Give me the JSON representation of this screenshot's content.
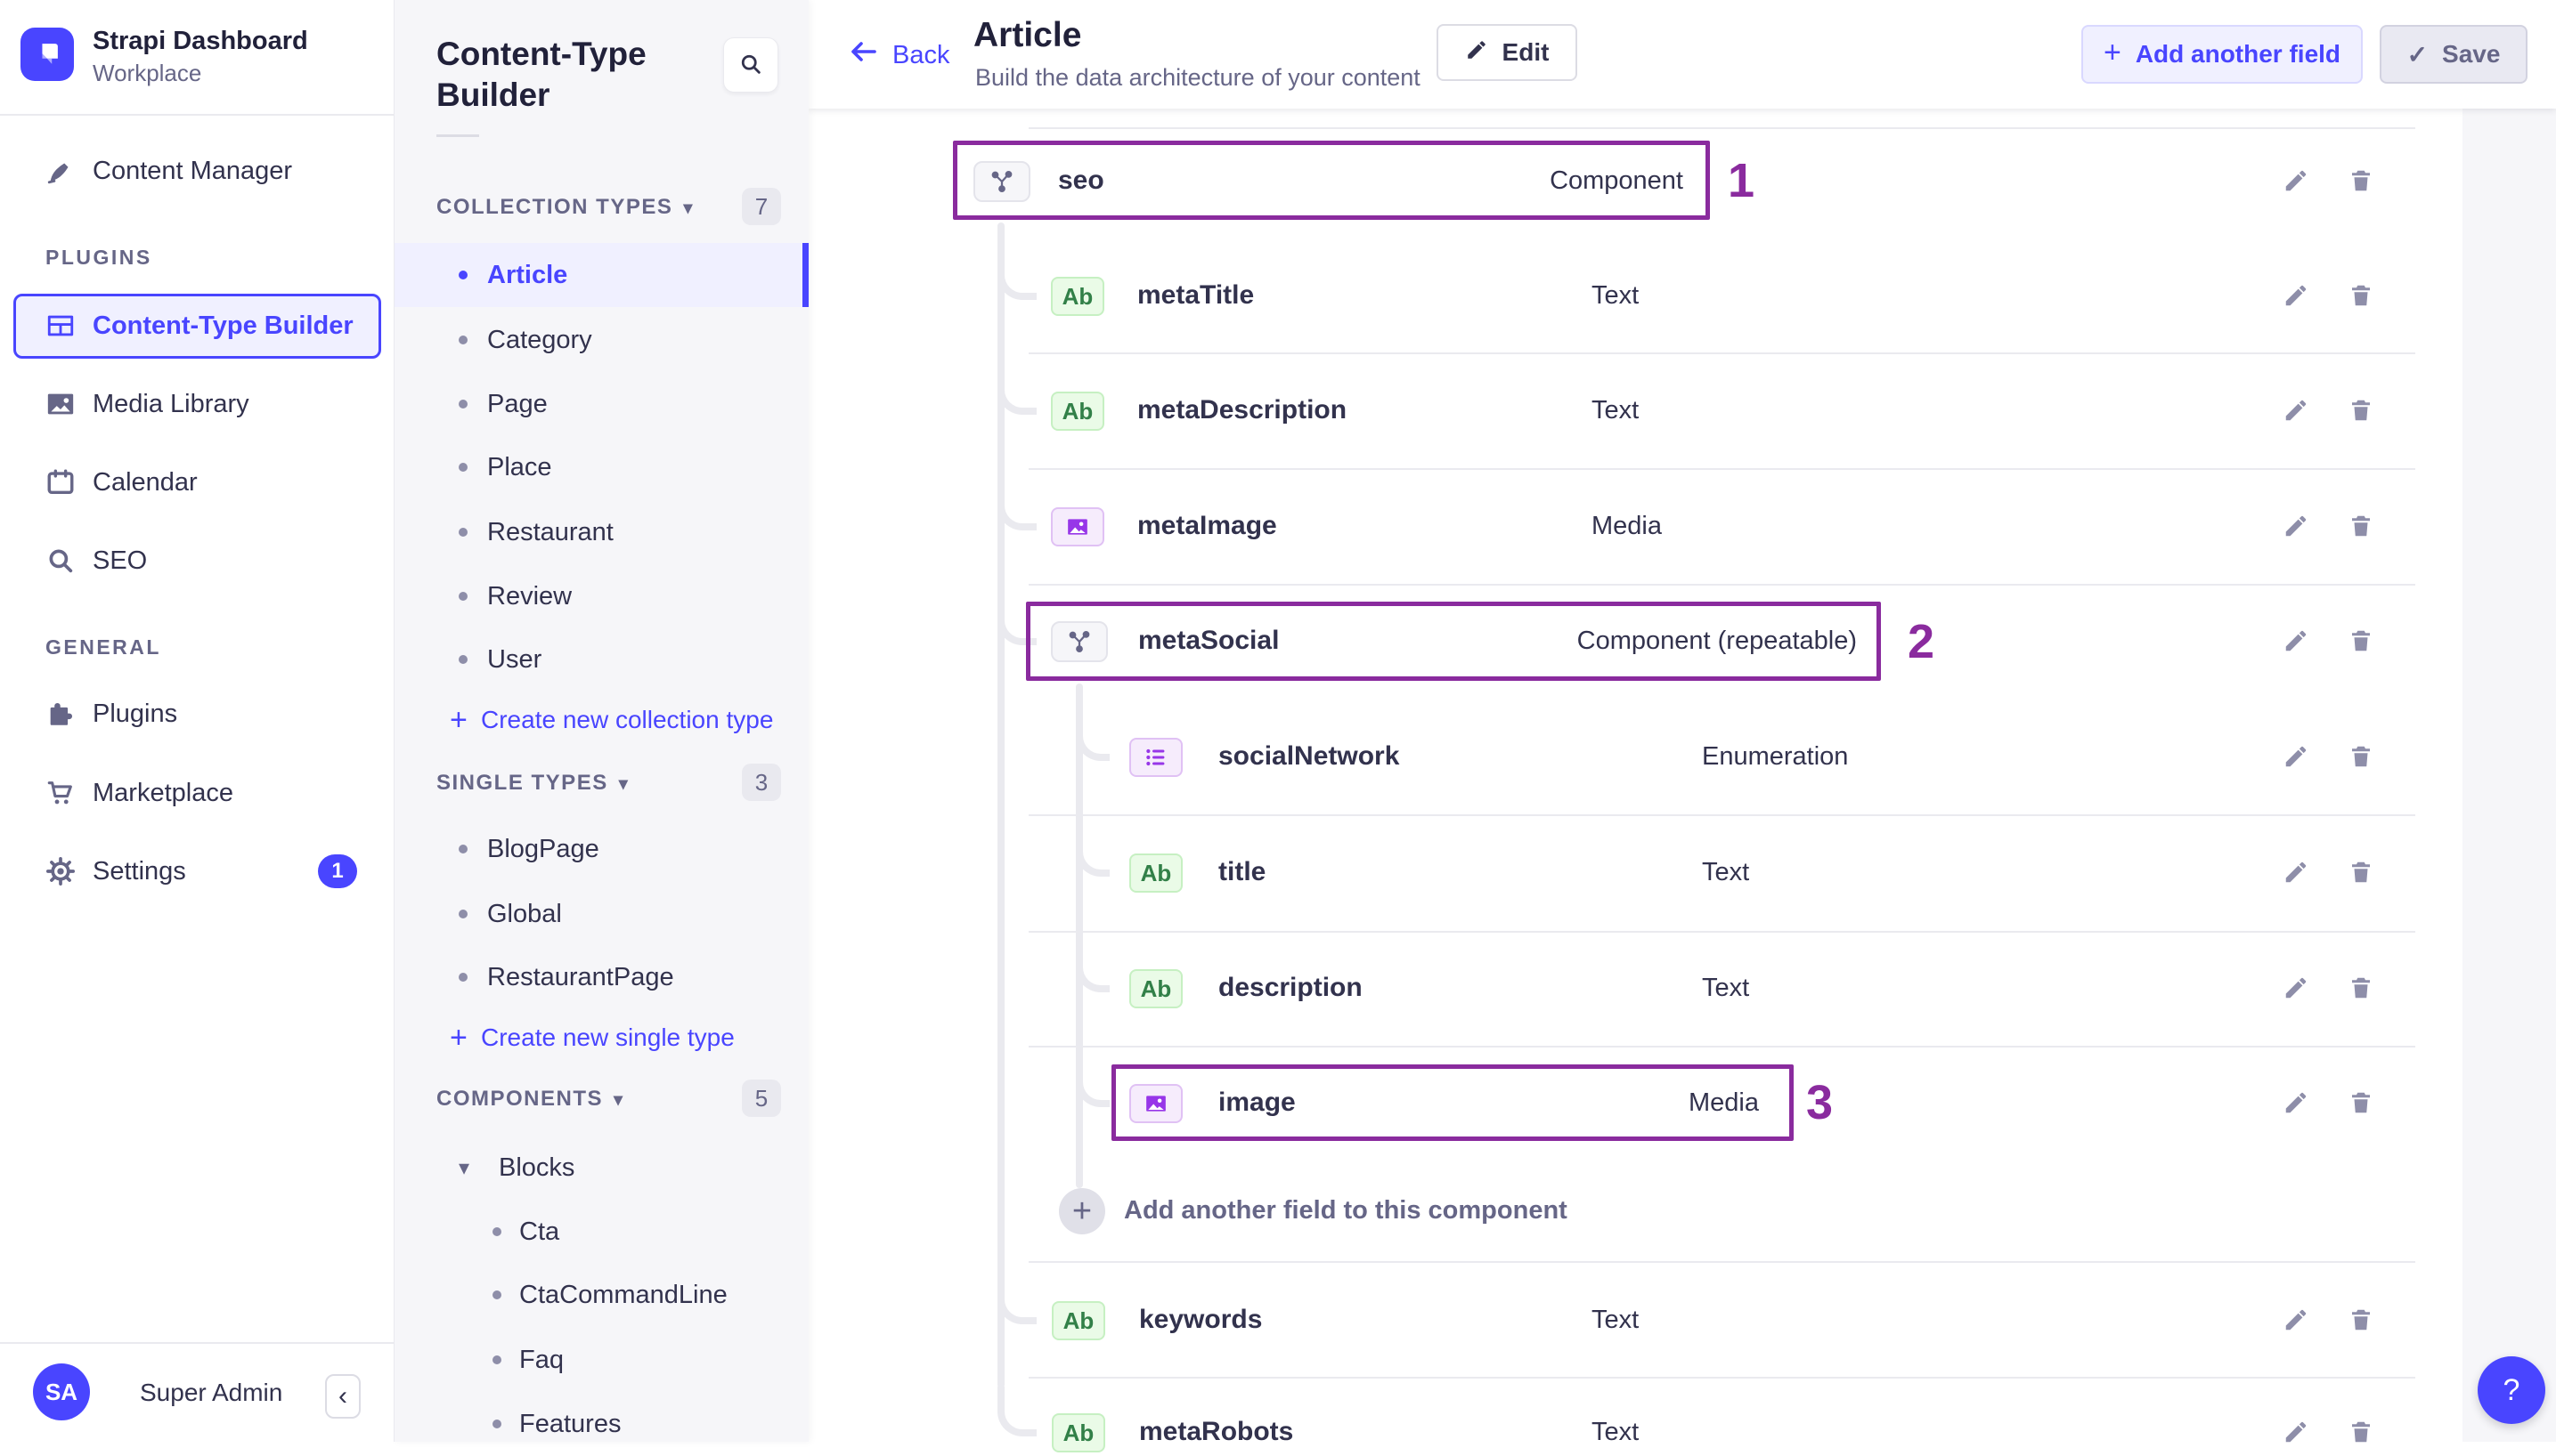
{
  "colors": {
    "primary": "#4945ff",
    "annotation": "#8a2b9e",
    "panel_bg": "#f6f6f9"
  },
  "icons": {
    "caret_down": "▾",
    "plus": "+",
    "chevron_left": "‹",
    "help": "?",
    "check": "✓",
    "ab": "Ab"
  },
  "sidebar": {
    "app_title": "Strapi Dashboard",
    "workspace": "Workplace",
    "sections": {
      "plugins": "PLUGINS",
      "general": "GENERAL"
    },
    "items": [
      {
        "label": "Content Manager"
      },
      {
        "label": "Content-Type Builder"
      },
      {
        "label": "Media Library"
      },
      {
        "label": "Calendar"
      },
      {
        "label": "SEO"
      },
      {
        "label": "Plugins"
      },
      {
        "label": "Marketplace"
      },
      {
        "label": "Settings",
        "badge": "1"
      }
    ],
    "user": {
      "initials": "SA",
      "name": "Super Admin"
    }
  },
  "builder_panel": {
    "title": "Content-Type Builder",
    "collection_types": {
      "label": "COLLECTION TYPES",
      "count": "7",
      "items": [
        "Article",
        "Category",
        "Page",
        "Place",
        "Restaurant",
        "Review",
        "User"
      ],
      "create": "Create new collection type"
    },
    "single_types": {
      "label": "SINGLE TYPES",
      "count": "3",
      "items": [
        "BlogPage",
        "Global",
        "RestaurantPage"
      ],
      "create": "Create new single type"
    },
    "components": {
      "label": "COMPONENTS",
      "count": "5",
      "group": "Blocks",
      "items": [
        "Cta",
        "CtaCommandLine",
        "Faq",
        "Features"
      ]
    }
  },
  "header": {
    "back": "Back",
    "title": "Article",
    "subtitle": "Build the data architecture of your content",
    "edit": "Edit",
    "add_field": "Add another field",
    "save": "Save"
  },
  "fields": {
    "rows": [
      {
        "name": "seo",
        "type": "Component",
        "icon": "component",
        "annotation": "1"
      },
      {
        "name": "metaTitle",
        "type": "Text",
        "icon": "text"
      },
      {
        "name": "metaDescription",
        "type": "Text",
        "icon": "text"
      },
      {
        "name": "metaImage",
        "type": "Media",
        "icon": "media"
      },
      {
        "name": "metaSocial",
        "type": "Component (repeatable)",
        "icon": "component",
        "annotation": "2"
      },
      {
        "name": "socialNetwork",
        "type": "Enumeration",
        "icon": "enumeration"
      },
      {
        "name": "title",
        "type": "Text",
        "icon": "text"
      },
      {
        "name": "description",
        "type": "Text",
        "icon": "text"
      },
      {
        "name": "image",
        "type": "Media",
        "icon": "media",
        "annotation": "3"
      },
      {
        "name": "keywords",
        "type": "Text",
        "icon": "text"
      },
      {
        "name": "metaRobots",
        "type": "Text",
        "icon": "text"
      }
    ],
    "add_to_component": "Add another field to this component"
  }
}
